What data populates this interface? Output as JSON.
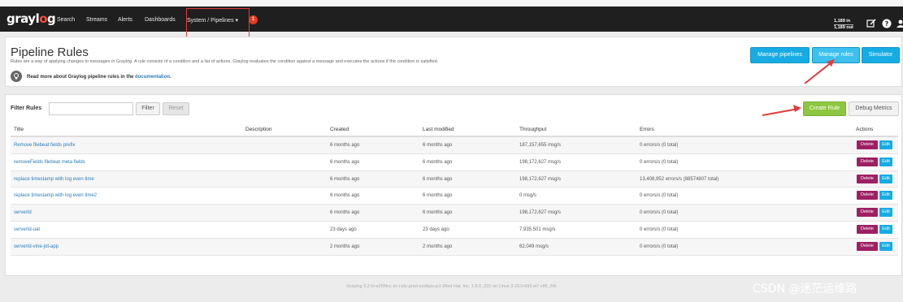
{
  "navbar": {
    "logo_text_1": "grayl",
    "logo_text_2": "o",
    "logo_text_3": "g",
    "items": [
      {
        "label": "Search"
      },
      {
        "label": "Streams"
      },
      {
        "label": "Alerts"
      },
      {
        "label": "Dashboards"
      },
      {
        "label": "System / Pipelines ▾"
      }
    ],
    "notification_count": "1",
    "throughput_in": "1,189 in",
    "throughput_out": "1,189 out"
  },
  "header": {
    "title": "Pipeline Rules",
    "description": "Rules are a way of applying changes to messages in Graylog. A rule consists of a condition and a list of actions. Graylog evaluates the condition against a message and executes the actions if the condition is satisfied.",
    "readmore_prefix": "Read more about Graylog pipeline rules in the ",
    "readmore_link": "documentation",
    "readmore_suffix": ".",
    "buttons": {
      "manage_pipelines": "Manage pipelines",
      "manage_rules": "Manage rules",
      "simulator": "Simulator"
    }
  },
  "filter": {
    "label": "Filter Rules",
    "value": "",
    "filter_button": "Filter",
    "reset_button": "Reset",
    "create_rule": "Create Rule",
    "debug_metrics": "Debug Metrics"
  },
  "table": {
    "columns": {
      "title": "Title",
      "description": "Description",
      "created": "Created",
      "modified": "Last modified",
      "throughput": "Throughput",
      "errors": "Errors",
      "actions": "Actions"
    },
    "delete_label": "Delete",
    "edit_label": "Edit",
    "rows": [
      {
        "title": "Remove filebeat fields prefix",
        "description": "",
        "created": "6 months ago",
        "modified": "6 months ago",
        "throughput": "187,157,655 msg/s",
        "errors": "0 errors/s (0 total)"
      },
      {
        "title": "removeFields filebeat meta fields",
        "description": "",
        "created": "6 months ago",
        "modified": "6 months ago",
        "throughput": "198,172,627 msg/s",
        "errors": "0 errors/s (0 total)"
      },
      {
        "title": "replace timestamp with log even time",
        "description": "",
        "created": "6 months ago",
        "modified": "6 months ago",
        "throughput": "198,172,627 msg/s",
        "errors": "13,408,952 errors/s (88574807 total)"
      },
      {
        "title": "replace timestamp with log even time2",
        "description": "",
        "created": "6 months ago",
        "modified": "6 months ago",
        "throughput": "0 msg/s",
        "errors": "0 errors/s (0 total)"
      },
      {
        "title": "serverId",
        "description": "",
        "created": "6 months ago",
        "modified": "6 months ago",
        "throughput": "198,172,627 msg/s",
        "errors": "0 errors/s (0 total)"
      },
      {
        "title": "serverId-uat",
        "description": "",
        "created": "23 days ago",
        "modified": "23 days ago",
        "throughput": "7,935,501 msg/s",
        "errors": "0 errors/s (0 total)"
      },
      {
        "title": "serverId-vine-jot-app",
        "description": "",
        "created": "2 months ago",
        "modified": "2 months ago",
        "throughput": "62,049 msg/s",
        "errors": "0 errors/s (0 total)"
      }
    ]
  },
  "footer": {
    "text": "Graylog 3.2.6+e255fcc on i-jdy-prod-szxfpzs-js1 (Red Hat, Inc. 1.8.0_322 on Linux 3.10.0-693.el7.x86_64)"
  },
  "watermark": "CSDN @迷茫运维路",
  "colors": {
    "navbar": "#1f1f1f",
    "accent_blue": "#16ace3",
    "create_green": "#8dc63f",
    "delete_purple": "#9e1f63",
    "annotation_red": "#e53b3b"
  }
}
